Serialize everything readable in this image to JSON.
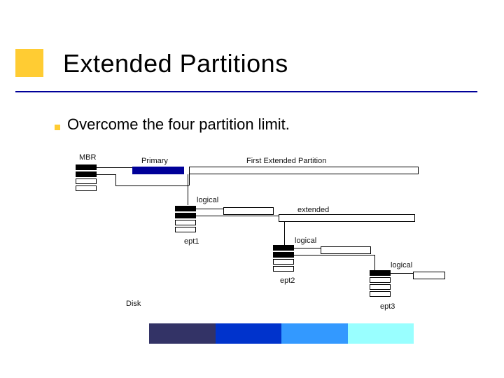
{
  "title": "Extended Partitions",
  "subtitle": "Overcome the four partition limit.",
  "labels": {
    "mbr": "MBR",
    "primary": "Primary",
    "first_ext": "First Extended Partition",
    "logical1": "logical",
    "extended": "extended",
    "ept1": "ept1",
    "logical2": "logical",
    "ept2": "ept2",
    "logical3": "logical",
    "ept3": "ept3",
    "disk": "Disk"
  },
  "colors": {
    "accent": "#ffcc33",
    "underline": "#000099",
    "disk_segments": [
      "#333366",
      "#0033cc",
      "#3399ff",
      "#99ffff"
    ]
  }
}
